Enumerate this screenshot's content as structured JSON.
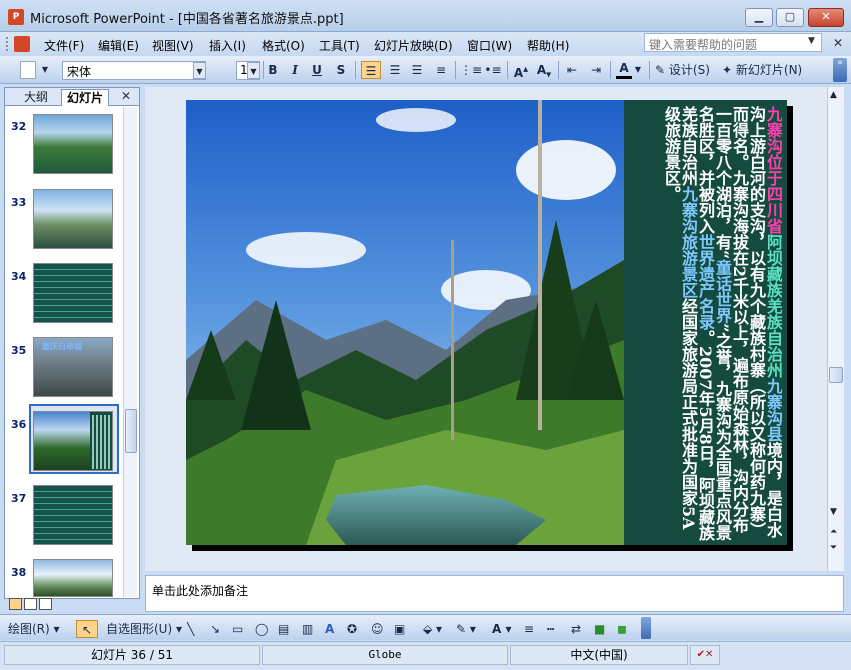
{
  "window": {
    "title": "Microsoft PowerPoint - [中国各省著名旅游景点.ppt]",
    "app_icon_glyph": "P"
  },
  "menu": {
    "items": [
      "文件(F)",
      "编辑(E)",
      "视图(V)",
      "插入(I)",
      "格式(O)",
      "工具(T)",
      "幻灯片放映(D)",
      "窗口(W)",
      "帮助(H)"
    ],
    "help_placeholder": "键入需要帮助的问题"
  },
  "toolbar": {
    "font_name": "宋体",
    "font_size": "18",
    "bold": "B",
    "italic": "I",
    "underline": "U",
    "shadow": "S",
    "design_label": "设计(S)",
    "new_slide_label": "新幻灯片(N)"
  },
  "panel": {
    "tab_outline": "大纲",
    "tab_slides": "幻灯片",
    "thumbnail_numbers": [
      "32",
      "33",
      "34",
      "35",
      "36",
      "37",
      "38"
    ],
    "thumb35_caption": "重庆白帝城",
    "selected": "36"
  },
  "slide": {
    "text_parts": [
      {
        "t": "九寨沟位于四川省",
        "c": "pink"
      },
      {
        "t": "阿坝藏族羌族自治州",
        "c": "green"
      },
      {
        "t": "九寨沟县",
        "c": "blue"
      },
      {
        "t": "境内，是白水沟上游白河的支沟，以有九个藏族村寨（所以又称何药九寨）而得名。九寨沟海拔在2千米以上，遍布原始森林，沟内分布一百零八个湖泊，有“",
        "c": "white"
      },
      {
        "t": "童话世界",
        "c": "blue"
      },
      {
        "t": "”之誉，九寨沟为全国重点风景名胜区，并被列入",
        "c": "white"
      },
      {
        "t": "世界遗产名录",
        "c": "blue"
      },
      {
        "t": "。2007年5月8日，阿坝藏族羌族自治州",
        "c": "white"
      },
      {
        "t": "九寨沟旅游景区",
        "c": "blue"
      },
      {
        "t": "经国家旅游局正式批准为国家5A级旅游景区。",
        "c": "white"
      }
    ]
  },
  "notes": {
    "placeholder": "单击此处添加备注"
  },
  "drawbar": {
    "draw_label": "绘图(R)",
    "autoshapes_label": "自选图形(U)"
  },
  "status": {
    "slide": "幻灯片 36 / 51",
    "design": "Globe",
    "language": "中文(中国)"
  },
  "colors": {
    "pink": "#ff3fb0",
    "green": "#5be0c4",
    "blue": "#7fc8ff",
    "white": "#ffffff",
    "slide_bg": "#154a3e"
  }
}
